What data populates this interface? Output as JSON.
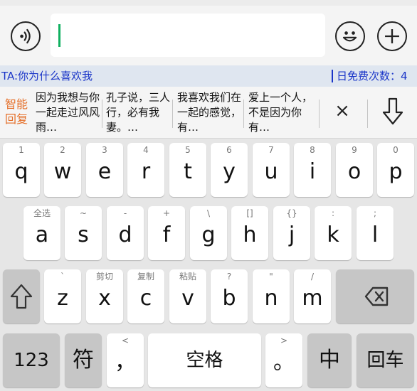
{
  "chat_input": {
    "voice_icon": "voice-waves-icon",
    "emoji_icon": "smiley-icon",
    "plus_icon": "plus-icon",
    "text_value": ""
  },
  "info_bar": {
    "ta_message": "TA:你为什么喜欢我",
    "free_count_label": "日免费次数：4"
  },
  "smart_reply": {
    "label_line1": "智能",
    "label_line2": "回复",
    "suggestions": [
      "因为我想与你一起走过风风雨…",
      "孔子说，三人行，必有我妻。…",
      "我喜欢我们在一起的感觉，有…",
      "爱上一个人，不是因为你有…"
    ],
    "close_symbol": "×",
    "expand_icon": "arrow-down-icon"
  },
  "keyboard": {
    "row1": [
      {
        "letter": "q",
        "hint": "1"
      },
      {
        "letter": "w",
        "hint": "2"
      },
      {
        "letter": "e",
        "hint": "3"
      },
      {
        "letter": "r",
        "hint": "4"
      },
      {
        "letter": "t",
        "hint": "5"
      },
      {
        "letter": "y",
        "hint": "6"
      },
      {
        "letter": "u",
        "hint": "7"
      },
      {
        "letter": "i",
        "hint": "8"
      },
      {
        "letter": "o",
        "hint": "9"
      },
      {
        "letter": "p",
        "hint": "0"
      }
    ],
    "row2": [
      {
        "letter": "a",
        "hint": "全选"
      },
      {
        "letter": "s",
        "hint": "~"
      },
      {
        "letter": "d",
        "hint": "-"
      },
      {
        "letter": "f",
        "hint": "+"
      },
      {
        "letter": "g",
        "hint": "\\"
      },
      {
        "letter": "h",
        "hint": "[]"
      },
      {
        "letter": "j",
        "hint": "{}"
      },
      {
        "letter": "k",
        "hint": ":"
      },
      {
        "letter": "l",
        "hint": ";"
      }
    ],
    "row3": [
      {
        "letter": "z",
        "hint": "`"
      },
      {
        "letter": "x",
        "hint": "剪切"
      },
      {
        "letter": "c",
        "hint": "复制"
      },
      {
        "letter": "v",
        "hint": "粘贴"
      },
      {
        "letter": "b",
        "hint": "?"
      },
      {
        "letter": "n",
        "hint": "\""
      },
      {
        "letter": "m",
        "hint": "/"
      }
    ],
    "shift_icon": "shift-arrow-icon",
    "backspace_icon": "backspace-icon",
    "bottom": {
      "numbers_label": "123",
      "symbols_label": "符",
      "comma_label": "，",
      "comma_hint": "<",
      "space_label": "空格",
      "period_label": "。",
      "period_hint": ">",
      "lang_label": "中",
      "enter_label": "回车"
    }
  }
}
